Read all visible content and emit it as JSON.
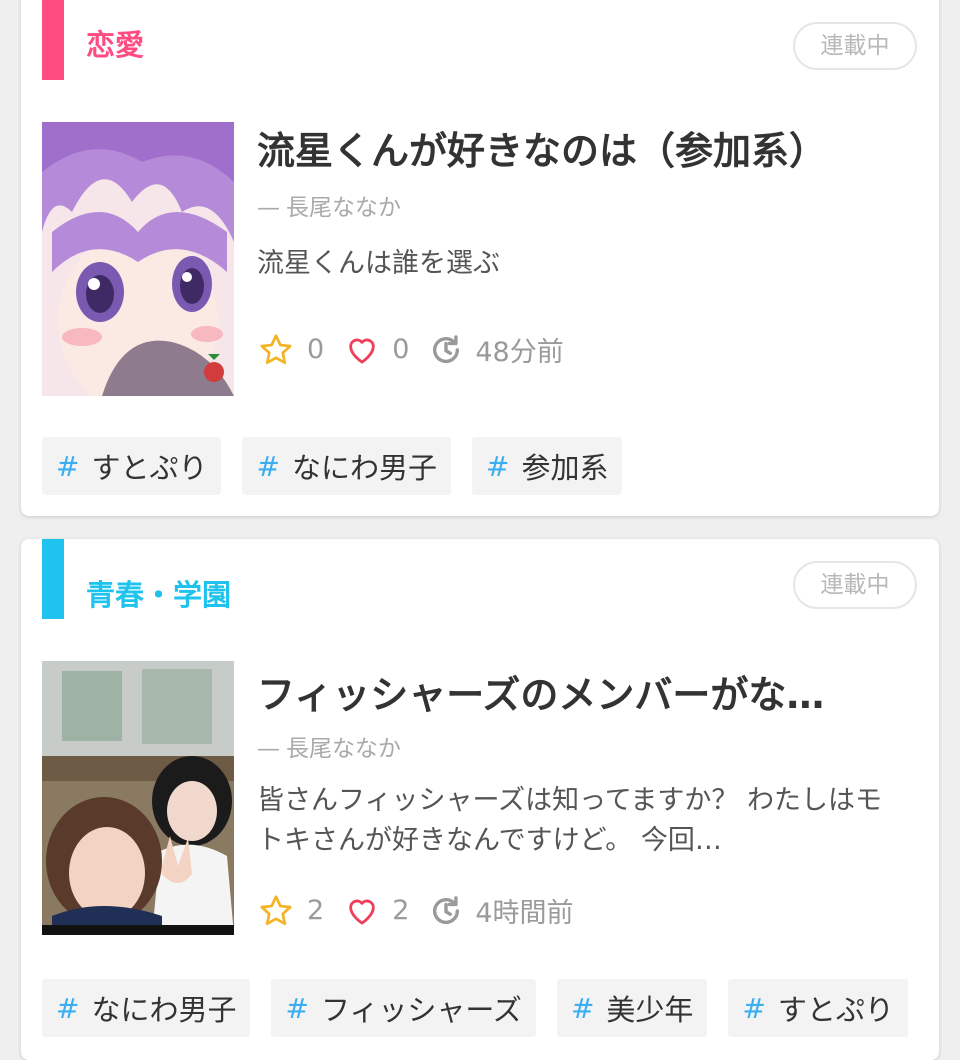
{
  "stories": [
    {
      "genre": "恋愛",
      "genre_color": "#ff4d82",
      "status": "連載中",
      "title": "流星くんが好きなのは（参加系）",
      "author_dash": "—",
      "author": "長尾ななか",
      "description": "流星くんは誰を選ぶ",
      "stars": "0",
      "hearts": "0",
      "updated": "48分前",
      "tags": [
        "すとぷり",
        "なにわ男子",
        "参加系"
      ]
    },
    {
      "genre": "青春・学園",
      "genre_color": "#1ec3ee",
      "status": "連載中",
      "title": "フィッシャーズのメンバーがな…",
      "author_dash": "—",
      "author": "長尾ななか",
      "description": "皆さんフィッシャーズは知ってますか？ わたしはモトキさんが好きなんですけど。 今回…",
      "stars": "2",
      "hearts": "2",
      "updated": "4時間前",
      "tags": [
        "なにわ男子",
        "フィッシャーズ",
        "美少年",
        "すとぷり"
      ]
    }
  ],
  "tag_hash": "#",
  "colors": {
    "star": "#f5b324",
    "heart": "#ef3f5c",
    "tag_hash": "#3aaef0"
  }
}
